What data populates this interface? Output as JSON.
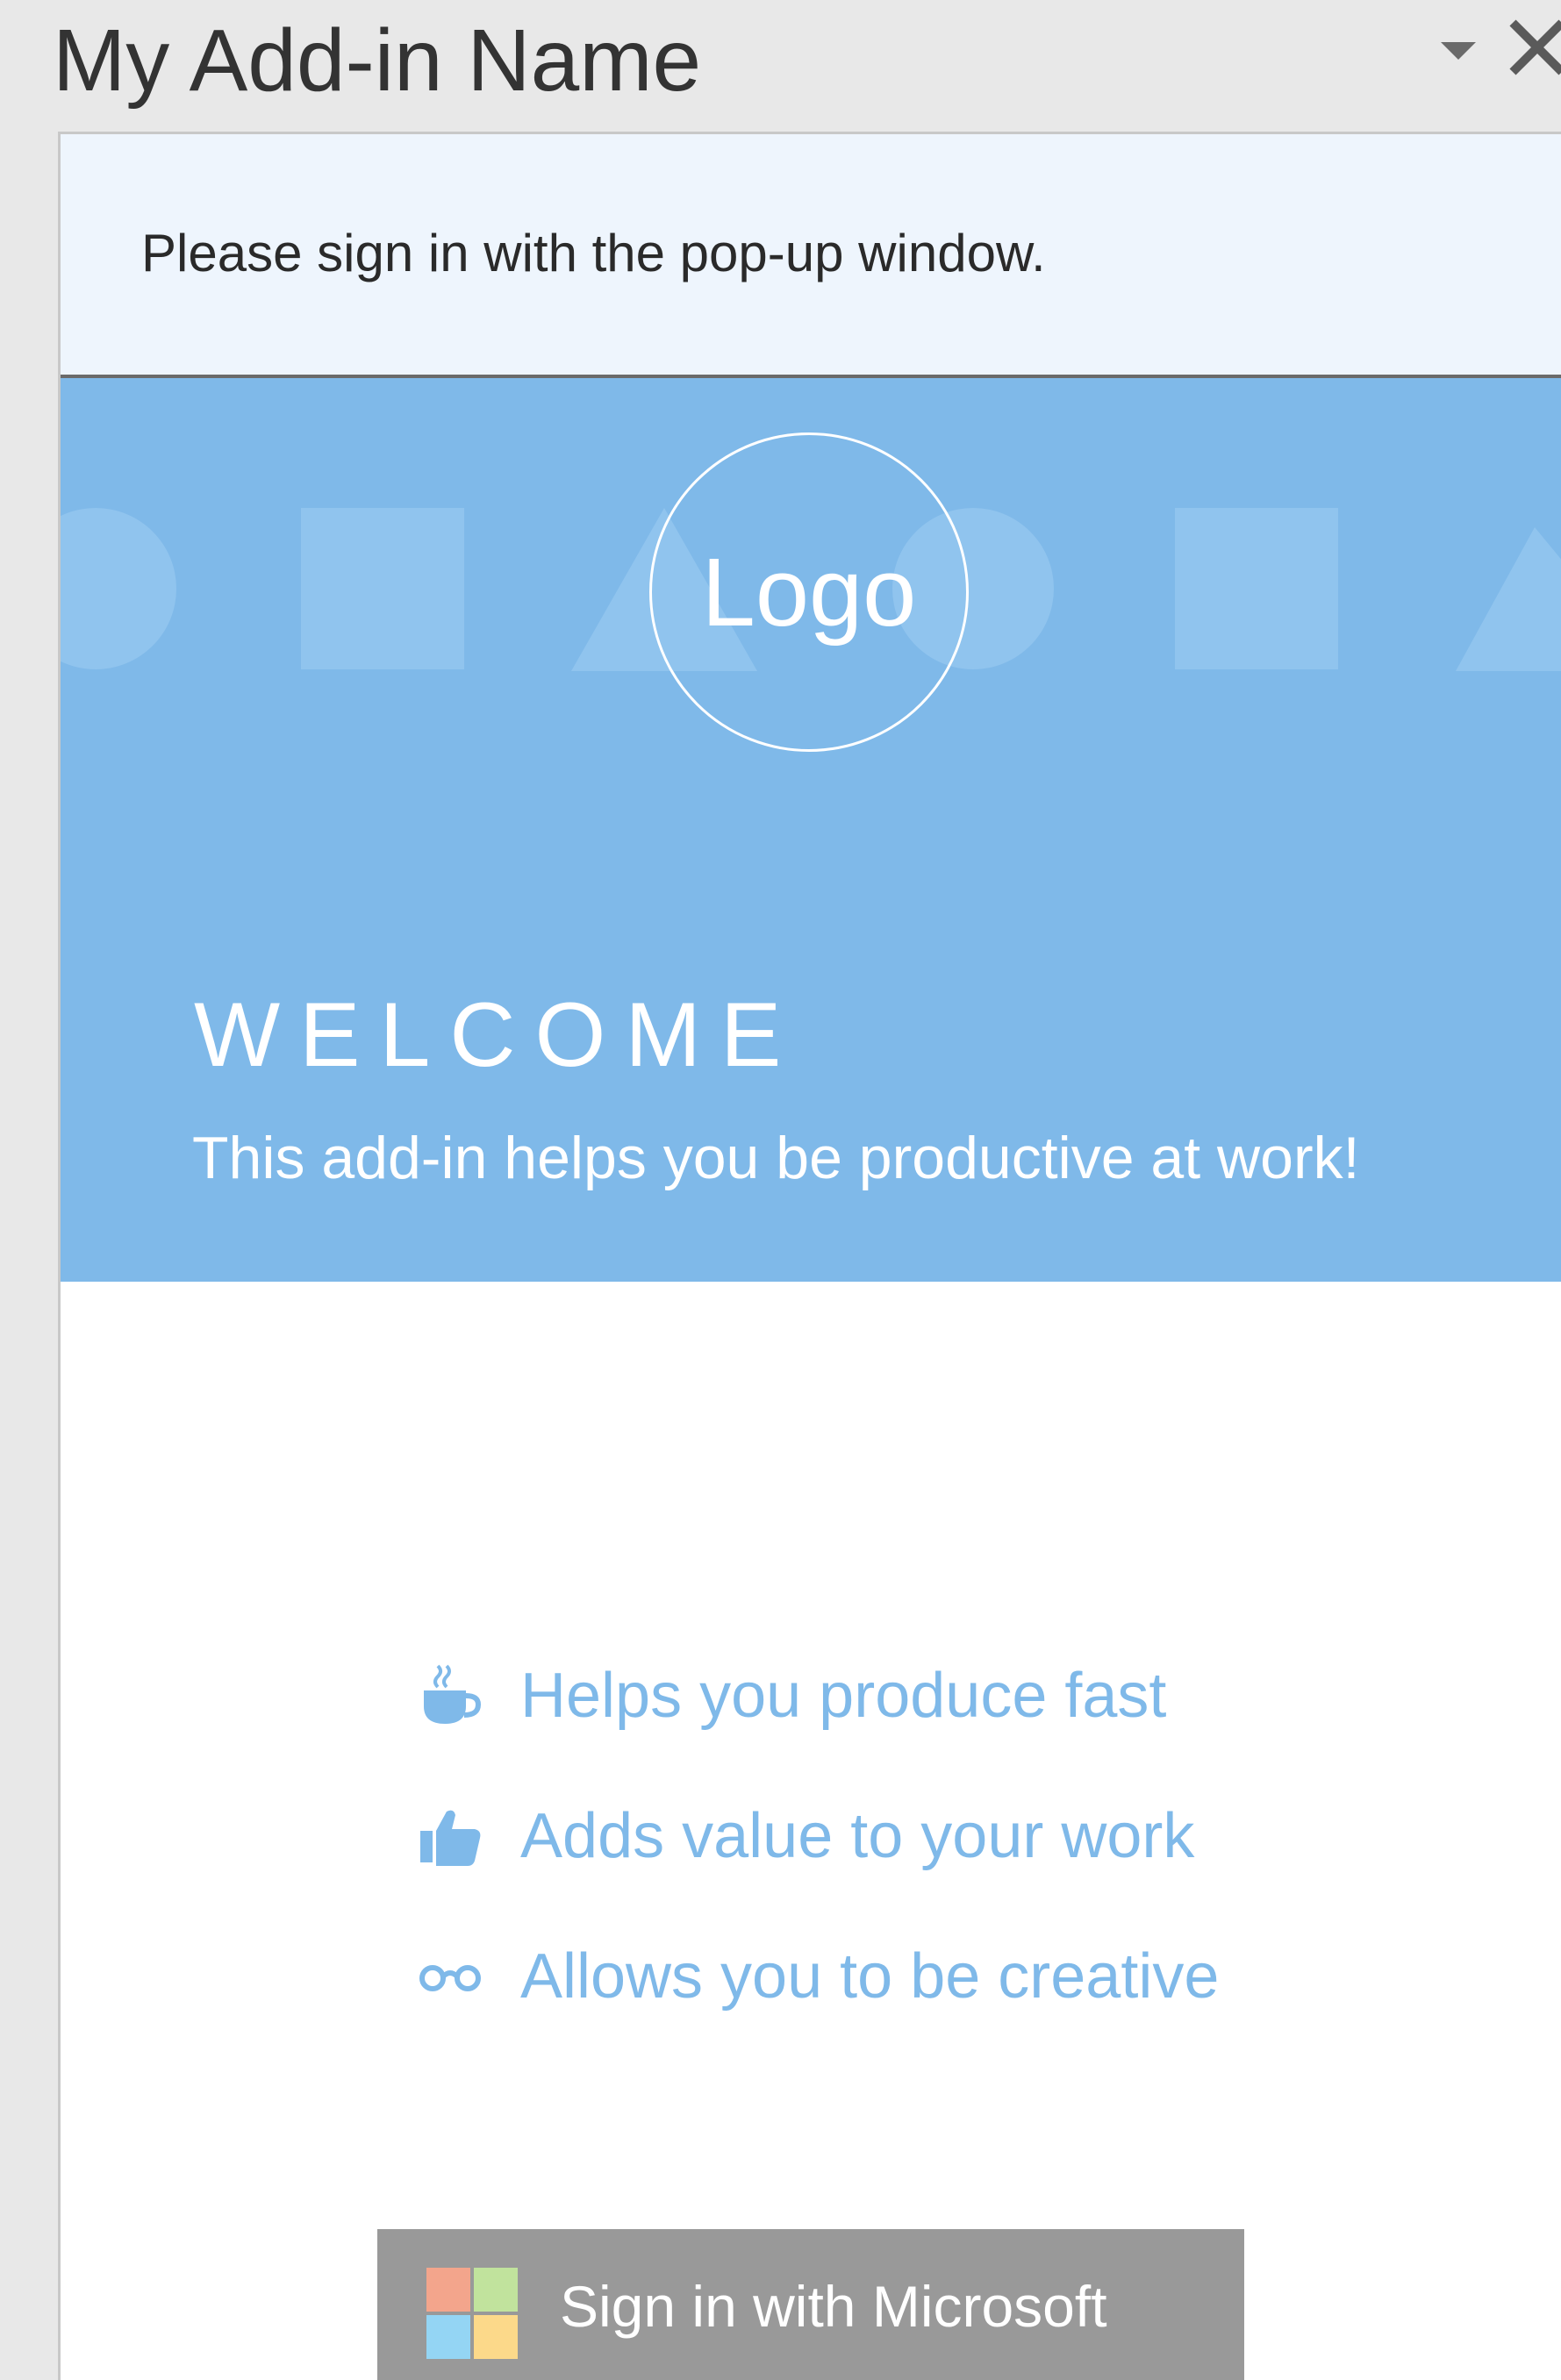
{
  "title_bar": {
    "title": "My Add-in Name",
    "dropdown_icon": "chevron-down-icon",
    "close_icon": "close-icon"
  },
  "notice": {
    "text": "Please sign in with the pop-up window."
  },
  "hero": {
    "logo_text": "Logo",
    "welcome": "WELCOME",
    "subtitle": "This add-in helps you be productive at work!"
  },
  "features": [
    {
      "icon": "coffee-icon",
      "label": "Helps you produce fast"
    },
    {
      "icon": "thumbs-up-icon",
      "label": "Adds value to your work"
    },
    {
      "icon": "glasses-icon",
      "label": "Allows you to be creative"
    }
  ],
  "signin": {
    "label": "Sign in with Microsoft",
    "icon": "microsoft-logo-icon"
  },
  "colors": {
    "accent": "#7fb9e9",
    "notice_bg": "#eef5fd",
    "button_bg": "#999999",
    "ms_red": "#f3a58c",
    "ms_green": "#c1e39d",
    "ms_blue": "#94d5f4",
    "ms_yellow": "#fcd98a"
  }
}
